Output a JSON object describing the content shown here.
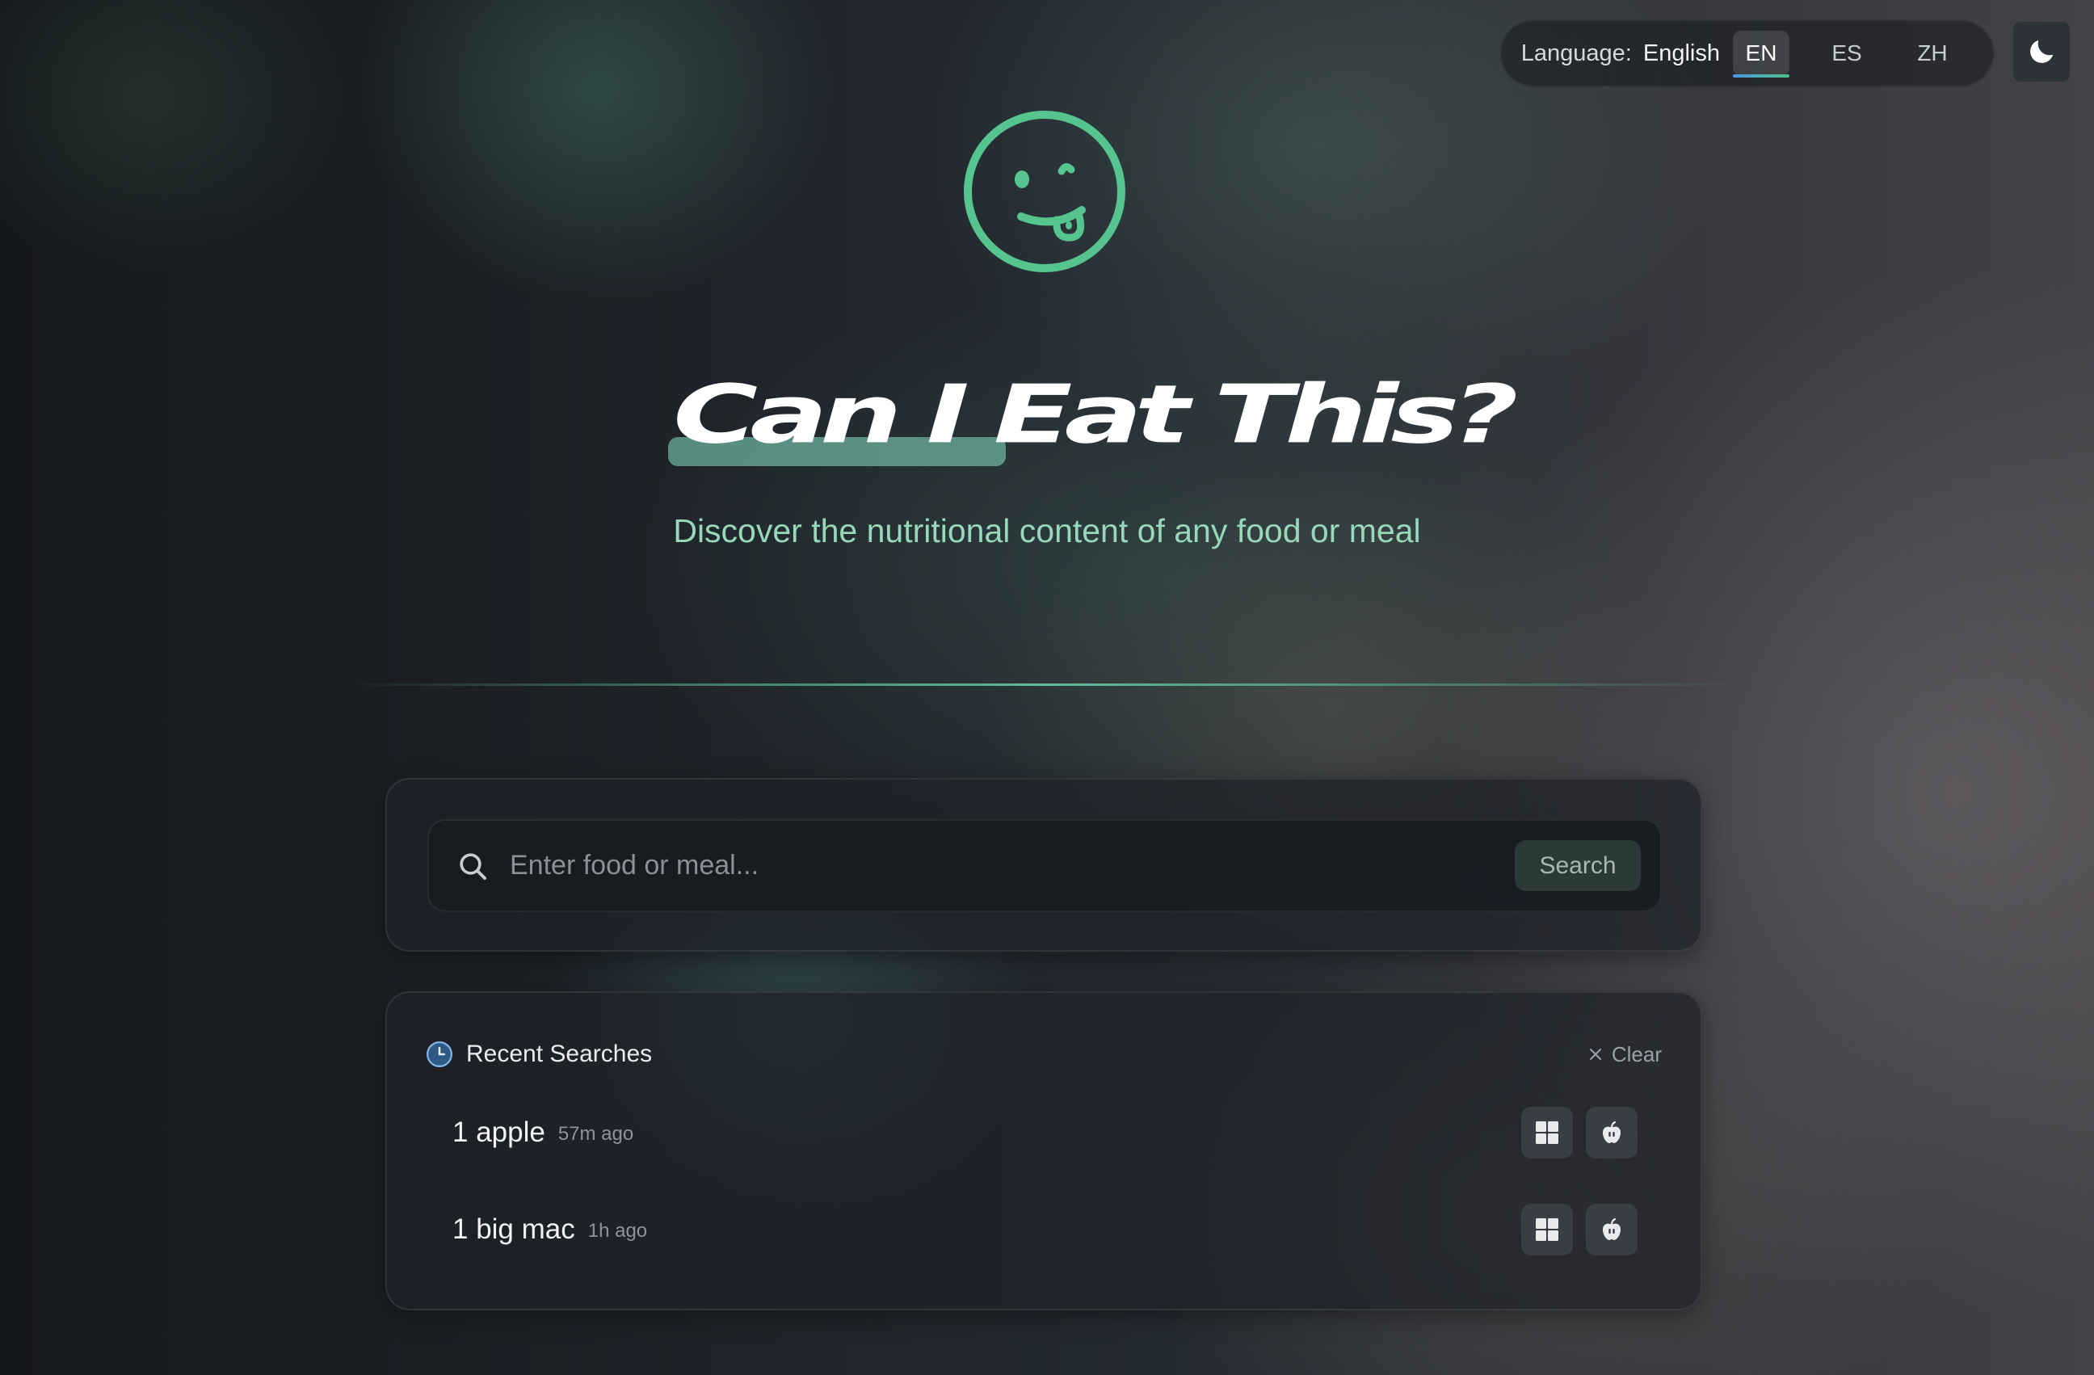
{
  "language": {
    "label": "Language:",
    "current": "English",
    "options": [
      "EN",
      "ES",
      "ZH"
    ],
    "active": "EN"
  },
  "theme_toggle": {
    "icon": "moon-icon"
  },
  "hero": {
    "logo_icon": "smiley-tongue-icon",
    "title": "Can I Eat This?",
    "subtitle": "Discover the nutritional content of any food or meal"
  },
  "search": {
    "placeholder": "Enter food or meal...",
    "value": "",
    "button_label": "Search",
    "icon": "search-icon"
  },
  "recent": {
    "title": "Recent Searches",
    "clear_label": "Clear",
    "items": [
      {
        "name": "1 apple",
        "time": "57m ago"
      },
      {
        "name": "1 big mac",
        "time": "1h ago"
      }
    ]
  },
  "colors": {
    "accent_green": "#55c48f",
    "subtitle_green": "#97d8b8",
    "card_bg": "#1e2128"
  }
}
